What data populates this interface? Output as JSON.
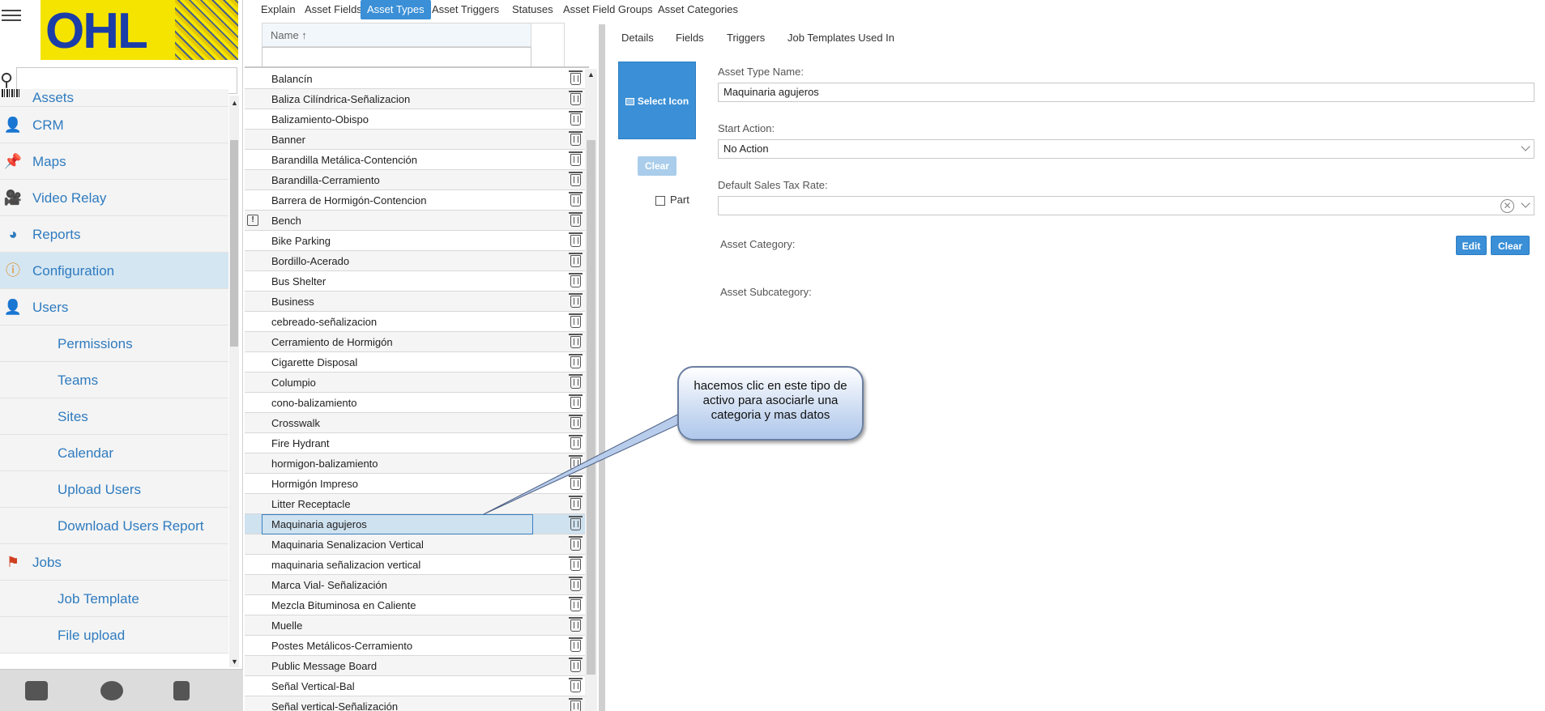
{
  "logo": {
    "text": "OHL"
  },
  "nav": {
    "items": [
      {
        "label": "Assets",
        "icon": "barcode-icon",
        "sub": false,
        "top": true
      },
      {
        "label": "CRM",
        "icon": "person-icon",
        "sub": false
      },
      {
        "label": "Maps",
        "icon": "pushpin-icon",
        "sub": false
      },
      {
        "label": "Video Relay",
        "icon": "video-relay-icon",
        "sub": false
      },
      {
        "label": "Reports",
        "icon": "pie-chart-icon",
        "sub": false
      },
      {
        "label": "Configuration",
        "icon": "info-icon",
        "sub": false,
        "selected": true
      },
      {
        "label": "Users",
        "icon": "user-icon",
        "sub": false
      },
      {
        "label": "Permissions",
        "sub": true
      },
      {
        "label": "Teams",
        "sub": true
      },
      {
        "label": "Sites",
        "sub": true
      },
      {
        "label": "Calendar",
        "sub": true
      },
      {
        "label": "Upload Users",
        "sub": true
      },
      {
        "label": "Download Users Report",
        "sub": true
      },
      {
        "label": "Jobs",
        "icon": "jobs-flag-icon",
        "sub": false
      },
      {
        "label": "Job Template",
        "sub": true
      },
      {
        "label": "File upload",
        "sub": true
      }
    ]
  },
  "toptabs": [
    {
      "label": "Explain"
    },
    {
      "label": "Asset Fields"
    },
    {
      "label": "Asset Types",
      "active": true
    },
    {
      "label": "Asset Triggers"
    },
    {
      "label": "Statuses"
    },
    {
      "label": "Asset Field Groups"
    },
    {
      "label": "Asset Categories"
    }
  ],
  "list": {
    "column_header": "Name ↑",
    "rows": [
      "Balancín",
      "Baliza Cilíndrica-Señalizacion",
      "Balizamiento-Obispo",
      "Banner",
      "Barandilla Metálica-Contención",
      "Barandilla-Cerramiento",
      "Barrera de Hormigón-Contencion",
      "Bench",
      "Bike Parking",
      "Bordillo-Acerado",
      "Bus Shelter",
      "Business",
      "cebreado-señalizacion",
      "Cerramiento de Hormigón",
      "Cigarette Disposal",
      "Columpio",
      "cono-balizamiento",
      "Crosswalk",
      "Fire Hydrant",
      "hormigon-balizamiento",
      "Hormigón Impreso",
      "Litter Receptacle",
      "Maquinaria agujeros",
      "Maquinaria Senalizacion Vertical",
      "maquinaria señalizacion vertical",
      "Marca Vial- Señalización",
      "Mezcla Bituminosa en Caliente",
      "Muelle",
      "Postes Metálicos-Cerramiento",
      "Public Message Board",
      "Señal Vertical-Bal",
      "Señal vertical-Señalización"
    ],
    "selected_index": 22,
    "info_icon_index": 7
  },
  "detail": {
    "subtabs": [
      "Details",
      "Fields",
      "Triggers",
      "Job Templates Used In"
    ],
    "select_icon_label": "Select Icon",
    "clear_icon_label": "Clear",
    "part_label": "Part",
    "asset_type_name_label": "Asset Type Name:",
    "asset_type_name_value": "Maquinaria agujeros",
    "start_action_label": "Start Action:",
    "start_action_value": "No Action",
    "sales_tax_label": "Default Sales Tax Rate:",
    "sales_tax_value": "",
    "asset_category_label": "Asset Category:",
    "asset_subcategory_label": "Asset Subcategory:",
    "edit_label": "Edit",
    "clear_label": "Clear"
  },
  "callout": {
    "text": "hacemos clic en este tipo de activo para asociarle una categoria y mas datos"
  },
  "colors": {
    "accent": "#3a8fd6",
    "nav_text": "#2f7bbf",
    "selected_row": "#cfe2f0"
  }
}
